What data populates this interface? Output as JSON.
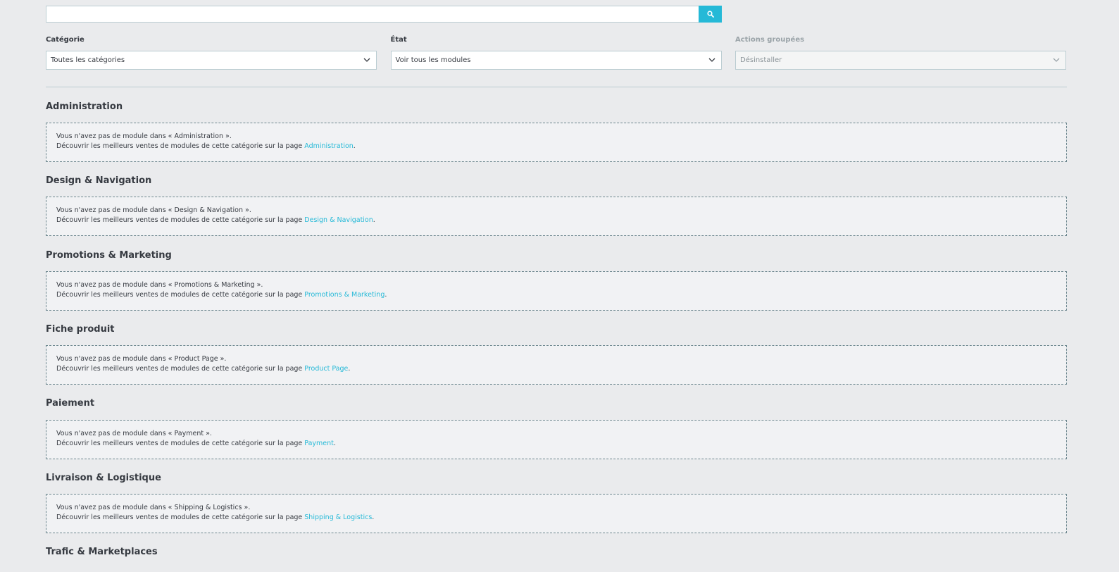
{
  "search": {
    "value": "",
    "placeholder": "",
    "button_icon": "search-icon"
  },
  "filters": {
    "category": {
      "label": "Catégorie",
      "selected": "Toutes les catégories"
    },
    "state": {
      "label": "État",
      "selected": "Voir tous les modules"
    },
    "bulk_actions": {
      "label": "Actions groupées",
      "selected": "Désinstaller",
      "disabled": true
    }
  },
  "accent_color": "#25b9d7",
  "categories": [
    {
      "title": "Administration",
      "line1": "Vous n'avez pas de module dans « Administration ».",
      "line2_prefix": "Découvrir les meilleurs ventes de modules de cette catégorie sur la page ",
      "link": "Administration",
      "suffix": "."
    },
    {
      "title": "Design & Navigation",
      "line1": "Vous n'avez pas de module dans « Design & Navigation ».",
      "line2_prefix": "Découvrir les meilleurs ventes de modules de cette catégorie sur la page ",
      "link": "Design & Navigation",
      "suffix": "."
    },
    {
      "title": "Promotions & Marketing",
      "line1": "Vous n'avez pas de module dans « Promotions & Marketing ».",
      "line2_prefix": "Découvrir les meilleurs ventes de modules de cette catégorie sur la page ",
      "link": "Promotions & Marketing",
      "suffix": "."
    },
    {
      "title": "Fiche produit",
      "line1": "Vous n'avez pas de module dans « Product Page ».",
      "line2_prefix": "Découvrir les meilleurs ventes de modules de cette catégorie sur la page ",
      "link": "Product Page",
      "suffix": "."
    },
    {
      "title": "Paiement",
      "line1": "Vous n'avez pas de module dans « Payment ».",
      "line2_prefix": "Découvrir les meilleurs ventes de modules de cette catégorie sur la page ",
      "link": "Payment",
      "suffix": "."
    },
    {
      "title": "Livraison & Logistique",
      "line1": "Vous n'avez pas de module dans « Shipping & Logistics ».",
      "line2_prefix": "Découvrir les meilleurs ventes de modules de cette catégorie sur la page ",
      "link": "Shipping & Logistics",
      "suffix": "."
    },
    {
      "title": "Trafic & Marketplaces"
    }
  ]
}
